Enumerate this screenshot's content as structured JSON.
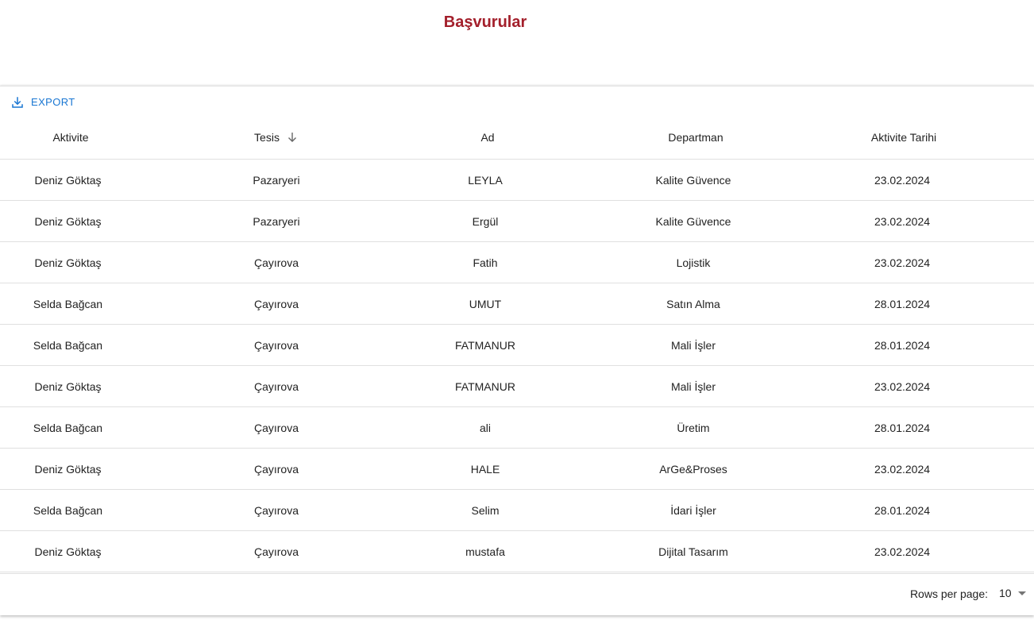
{
  "page": {
    "title": "Başvurular"
  },
  "toolbar": {
    "export_label": "EXPORT",
    "export_icon": "download-icon"
  },
  "table": {
    "columns": [
      {
        "label": "Aktivite"
      },
      {
        "label": "Tesis",
        "sorted": "descending",
        "sort_icon": "arrow-down-icon"
      },
      {
        "label": "Ad"
      },
      {
        "label": "Departman"
      },
      {
        "label": "Aktivite Tarihi"
      }
    ],
    "rows": [
      [
        "Deniz Göktaş",
        "Pazaryeri",
        "LEYLA",
        "Kalite Güvence",
        "23.02.2024"
      ],
      [
        "Deniz Göktaş",
        "Pazaryeri",
        "Ergül",
        "Kalite Güvence",
        "23.02.2024"
      ],
      [
        "Deniz Göktaş",
        "Çayırova",
        "Fatih",
        "Lojistik",
        "23.02.2024"
      ],
      [
        "Selda Bağcan",
        "Çayırova",
        "UMUT",
        "Satın Alma",
        "28.01.2024"
      ],
      [
        "Selda Bağcan",
        "Çayırova",
        "FATMANUR",
        "Mali İşler",
        "28.01.2024"
      ],
      [
        "Deniz Göktaş",
        "Çayırova",
        "FATMANUR",
        "Mali İşler",
        "23.02.2024"
      ],
      [
        "Selda Bağcan",
        "Çayırova",
        "ali",
        "Üretim",
        "28.01.2024"
      ],
      [
        "Deniz Göktaş",
        "Çayırova",
        "HALE",
        "ArGe&Proses",
        "23.02.2024"
      ],
      [
        "Selda Bağcan",
        "Çayırova",
        "Selim",
        "İdari İşler",
        "28.01.2024"
      ],
      [
        "Deniz Göktaş",
        "Çayırova",
        "mustafa",
        "Dijital Tasarım",
        "23.02.2024"
      ]
    ]
  },
  "footer": {
    "rows_per_page_label": "Rows per page:",
    "rows_per_page_value": "10"
  },
  "colors": {
    "title": "#a31f2b",
    "accent": "#1976d2"
  }
}
